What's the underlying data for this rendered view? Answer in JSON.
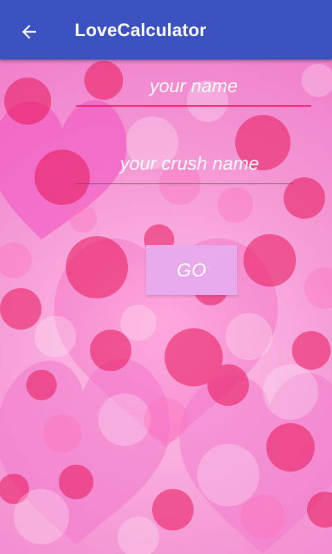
{
  "app": {
    "title": "LoveCalculator",
    "back_icon": "arrow-back-icon"
  },
  "form": {
    "name_placeholder": "your name",
    "name_value": "",
    "crush_placeholder": "your crush name",
    "crush_value": "",
    "go_label": "GO"
  },
  "colors": {
    "appbar": "#3a51bf",
    "accent_underline": "#ef1f6e",
    "button": "#e9aaec",
    "background": "#f7a7d8"
  },
  "background": {
    "description_icon": "hearts-bokeh-background"
  }
}
